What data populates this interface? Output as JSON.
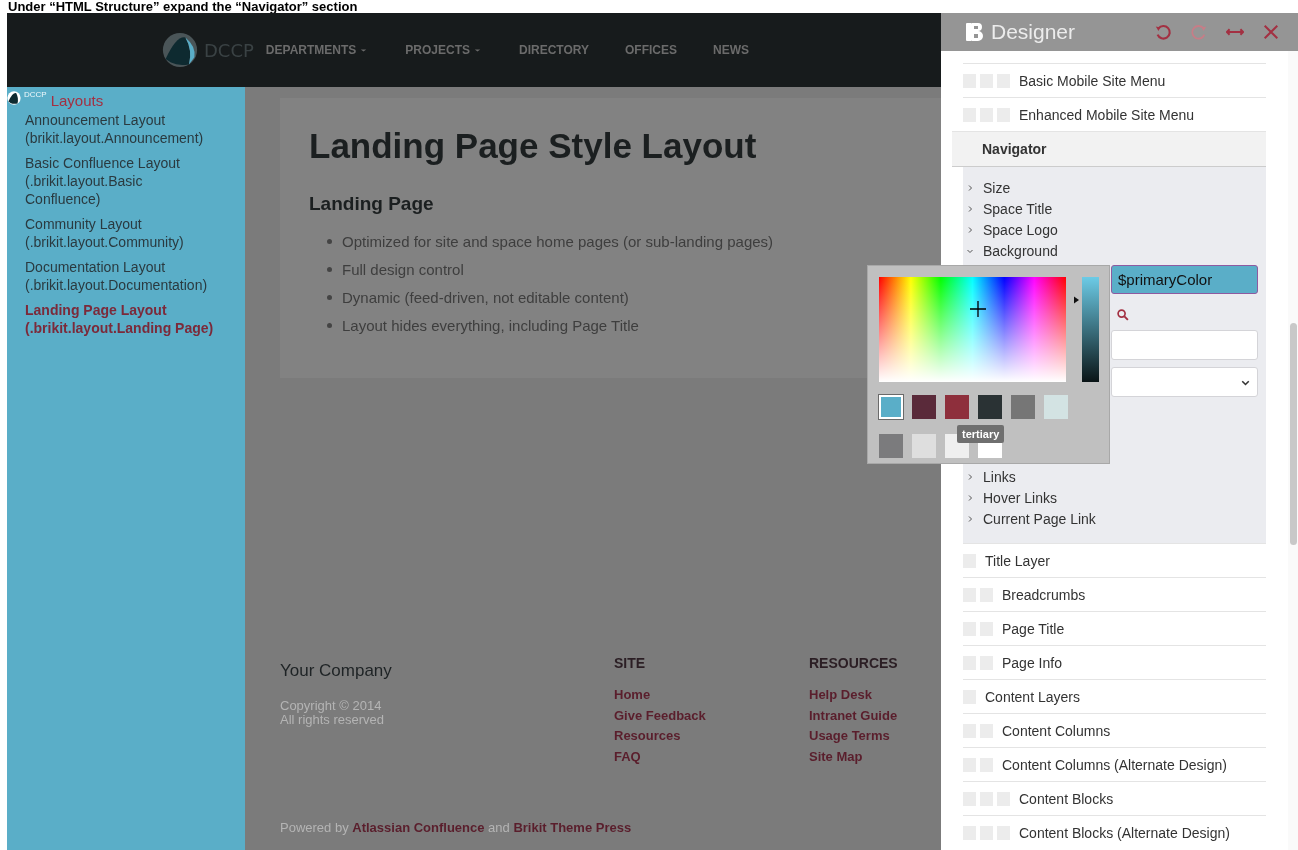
{
  "caption": "Under “HTML Structure” expand the “Navigator” section",
  "site": {
    "logo_text": "DCCP",
    "nav": [
      {
        "label": "DEPARTMENTS",
        "has_menu": true
      },
      {
        "label": "PROJECTS",
        "has_menu": true
      },
      {
        "label": "DIRECTORY",
        "has_menu": false
      },
      {
        "label": "OFFICES",
        "has_menu": false
      },
      {
        "label": "NEWS",
        "has_menu": false
      }
    ],
    "sidebar": {
      "logo_text": "DCCP",
      "title": "Layouts",
      "items": [
        {
          "label": "Announcement Layout (brikit.layout.Announcement)",
          "selected": false
        },
        {
          "label": "Basic Confluence Layout (.brikit.layout.Basic Confluence)",
          "selected": false
        },
        {
          "label": "Community Layout (.brikit.layout.Community)",
          "selected": false
        },
        {
          "label": "Documentation Layout (.brikit.layout.Documentation)",
          "selected": false
        },
        {
          "label": "Landing Page Layout (.brikit.layout.Landing Page)",
          "selected": true
        }
      ]
    },
    "content": {
      "title": "Landing Page Style Layout",
      "subtitle": "Landing Page",
      "bullets": [
        "Optimized for site and space home pages (or sub-landing pages)",
        "Full design control",
        "Dynamic (feed-driven, not editable content)",
        "Layout hides everything, including Page Title"
      ]
    },
    "footer": {
      "company": "Your Company",
      "copyright": [
        "Copyright © 2014",
        "All rights reserved"
      ],
      "columns": [
        {
          "heading": "SITE",
          "links": [
            "Home",
            "Give Feedback",
            "Resources",
            "FAQ"
          ]
        },
        {
          "heading": "RESOURCES",
          "links": [
            "Help Desk",
            "Intranet Guide",
            "Usage Terms",
            "Site Map"
          ]
        }
      ],
      "powered": {
        "prefix": "Powered by",
        "first_link": "Atlassian Confluence",
        "joiner": "and",
        "second_link": "Brikit Theme Press"
      }
    }
  },
  "designer": {
    "title": "Designer",
    "top_rows": [
      {
        "label": "Basic Mobile Site Menu"
      },
      {
        "label": "Enhanced Mobile Site Menu"
      }
    ],
    "navigator": {
      "title": "Navigator",
      "items": [
        {
          "label": "Size",
          "expanded": false
        },
        {
          "label": "Space Title",
          "expanded": false
        },
        {
          "label": "Space Logo",
          "expanded": false
        },
        {
          "label": "Background",
          "expanded": true,
          "color_value": "$primaryColor"
        },
        {
          "label": "Links",
          "expanded": false
        },
        {
          "label": "Hover Links",
          "expanded": false
        },
        {
          "label": "Current Page Link",
          "expanded": false
        }
      ]
    },
    "layers": [
      {
        "label": "Title Layer",
        "children": [
          {
            "label": "Breadcrumbs"
          },
          {
            "label": "Page Title"
          },
          {
            "label": "Page Info"
          }
        ]
      },
      {
        "label": "Content Layers",
        "children": [
          {
            "label": "Content Columns"
          },
          {
            "label": "Content Columns (Alternate Design)",
            "children": [
              {
                "label": "Content Blocks"
              },
              {
                "label": "Content Blocks (Alternate Design)"
              }
            ]
          }
        ]
      }
    ]
  },
  "color_picker": {
    "tooltip": "tertiary",
    "level": 0.78,
    "swatches": [
      {
        "color": "#5aaec8",
        "selected": true
      },
      {
        "color": "#5a2a3a",
        "selected": false
      },
      {
        "color": "#8e2f3c",
        "selected": false
      },
      {
        "color": "#2a3234",
        "selected": false
      },
      {
        "color": "#767676",
        "selected": false
      },
      {
        "color": "#d3e3e3",
        "selected": false
      },
      {
        "color": "#7b7b7d",
        "selected": false
      },
      {
        "color": "#dedede",
        "selected": false
      },
      {
        "color": "#efefef",
        "selected": false
      },
      {
        "color": "#ffffff",
        "selected": false
      }
    ]
  }
}
